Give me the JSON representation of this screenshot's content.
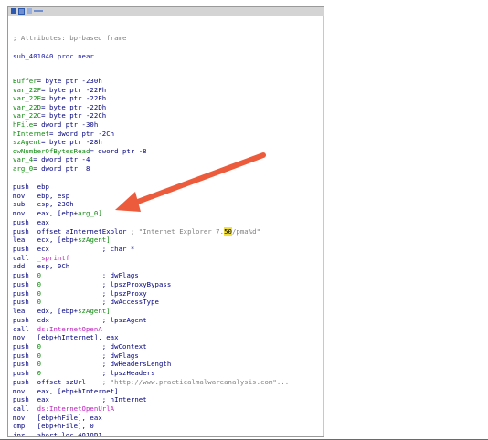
{
  "window": {
    "title_icons": [
      "graph-view-icon",
      "window-icon",
      "disassembly-icon"
    ],
    "frame_comment": "; Attributes: bp-based frame",
    "proc_line": "sub_401040 proc near"
  },
  "stack_vars": [
    {
      "name": "Buffer",
      "def": "= byte ptr -230h"
    },
    {
      "name": "var_22F",
      "def": "= byte ptr -22Fh"
    },
    {
      "name": "var_22E",
      "def": "= byte ptr -22Eh"
    },
    {
      "name": "var_22D",
      "def": "= byte ptr -22Dh"
    },
    {
      "name": "var_22C",
      "def": "= byte ptr -22Ch"
    },
    {
      "name": "hFile",
      "def": "= dword ptr -30h"
    },
    {
      "name": "hInternet",
      "def": "= dword ptr -2Ch"
    },
    {
      "name": "szAgent",
      "def": "= byte ptr -28h"
    },
    {
      "name": "dwNumberOfBytesRead",
      "def": "= dword ptr -8"
    },
    {
      "name": "var_4",
      "def": "= dword ptr -4"
    },
    {
      "name": "arg_0",
      "def": "= dword ptr  8"
    }
  ],
  "code": [
    {
      "mn": "push",
      "a": "ebp",
      "b": "",
      "cmt": ""
    },
    {
      "mn": "mov",
      "a": "ebp, esp",
      "b": "",
      "cmt": ""
    },
    {
      "mn": "sub",
      "a": "esp, 230h",
      "b": "",
      "cmt": ""
    },
    {
      "mn": "mov",
      "a": "eax, [ebp+",
      "b": "arg_0]",
      "cmt": ""
    },
    {
      "mn": "push",
      "a": "eax",
      "b": "",
      "cmt": ""
    },
    {
      "mn": "push",
      "a": "offset aInternetExplor",
      "b": "",
      "cmt": "; \"Internet Explorer 7.50/pma%d\""
    },
    {
      "mn": "lea",
      "a": "ecx, [ebp+",
      "b": "szAgent]",
      "cmt": ""
    },
    {
      "mn": "push",
      "a": "ecx",
      "b": "",
      "cmt": "; char *"
    },
    {
      "mn": "call",
      "a": "_sprintf",
      "b": "",
      "cmt": ""
    },
    {
      "mn": "add",
      "a": "esp, 0Ch",
      "b": "",
      "cmt": ""
    },
    {
      "mn": "push",
      "a": "0",
      "b": "",
      "cmt": "; dwFlags"
    },
    {
      "mn": "push",
      "a": "0",
      "b": "",
      "cmt": "; lpszProxyBypass"
    },
    {
      "mn": "push",
      "a": "0",
      "b": "",
      "cmt": "; lpszProxy"
    },
    {
      "mn": "push",
      "a": "0",
      "b": "",
      "cmt": "; dwAccessType"
    },
    {
      "mn": "lea",
      "a": "edx, [ebp+",
      "b": "szAgent]",
      "cmt": ""
    },
    {
      "mn": "push",
      "a": "edx",
      "b": "",
      "cmt": "; lpszAgent"
    },
    {
      "mn": "call",
      "a": "ds:InternetOpenA",
      "b": "",
      "cmt": ""
    },
    {
      "mn": "mov",
      "a": "[ebp+hInternet], eax",
      "b": "",
      "cmt": ""
    },
    {
      "mn": "push",
      "a": "0",
      "b": "",
      "cmt": "; dwContext"
    },
    {
      "mn": "push",
      "a": "0",
      "b": "",
      "cmt": "; dwFlags"
    },
    {
      "mn": "push",
      "a": "0",
      "b": "",
      "cmt": "; dwHeadersLength"
    },
    {
      "mn": "push",
      "a": "0",
      "b": "",
      "cmt": "; lpszHeaders"
    },
    {
      "mn": "push",
      "a": "offset szUrl",
      "b": "",
      "cmt": "; \"http://www.practicalmalwareanalysis.com\"..."
    },
    {
      "mn": "mov",
      "a": "eax, [ebp+hInternet]",
      "b": "",
      "cmt": ""
    },
    {
      "mn": "push",
      "a": "eax",
      "b": "",
      "cmt": "; hInternet"
    },
    {
      "mn": "call",
      "a": "ds:InternetOpenUrlA",
      "b": "",
      "cmt": ""
    },
    {
      "mn": "mov",
      "a": "[ebp+hFile], eax",
      "b": "",
      "cmt": ""
    },
    {
      "mn": "cmp",
      "a": "[ebp+hFile], 0",
      "b": "",
      "cmt": ""
    },
    {
      "mn": "jnz",
      "a": "short loc_4010B1",
      "b": "",
      "cmt": ""
    }
  ],
  "highlight": {
    "text": "50",
    "color": "#f4e23a"
  },
  "annotation": {
    "type": "arrow",
    "color": "#ec5b3c"
  }
}
